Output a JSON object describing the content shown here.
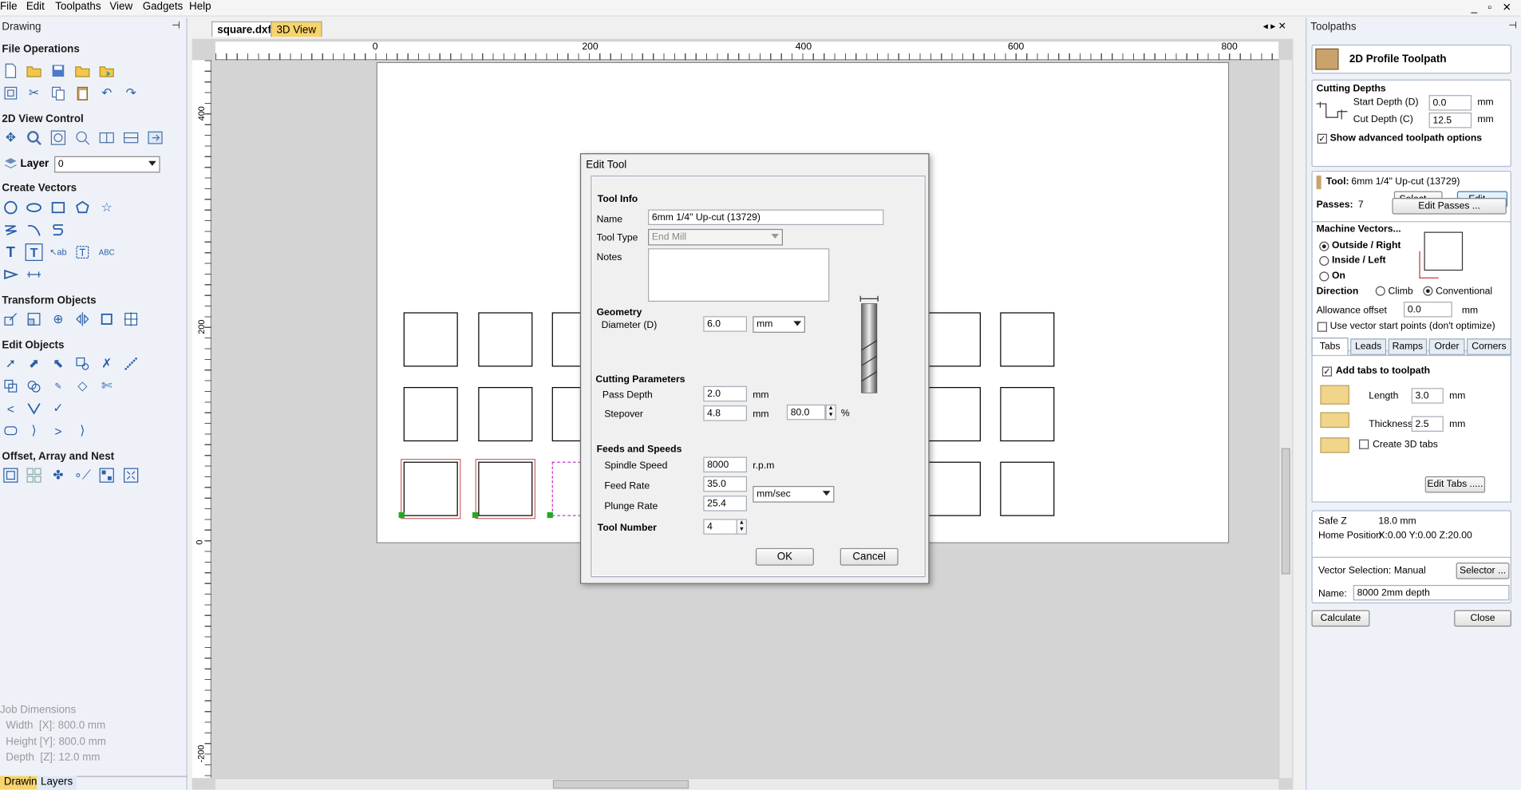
{
  "menu": [
    "File",
    "Edit",
    "Toolpaths",
    "View",
    "Gadgets",
    "Help"
  ],
  "left": {
    "title": "Drawing",
    "sections": {
      "file": "File Operations",
      "view2d": "2D View Control",
      "create": "Create Vectors",
      "transform": "Transform Objects",
      "edit": "Edit Objects",
      "offset": "Offset, Array and Nest"
    },
    "layer_label": "Layer",
    "layer_value": "0",
    "job": {
      "title": "Job Dimensions",
      "width": "Width  [X]: 800.0 mm",
      "height": "Height [Y]: 800.0 mm",
      "depth": "Depth  [Z]: 12.0 mm"
    },
    "bottom_tabs": [
      "Drawing",
      "Layers"
    ]
  },
  "doc_tabs": [
    "square.dxf",
    "3D View"
  ],
  "ruler": {
    "top": [
      "0",
      "200",
      "400",
      "600",
      "800"
    ],
    "left": [
      "400",
      "200",
      "0",
      "-200"
    ]
  },
  "dialog": {
    "title": "Edit Tool",
    "tool_info": "Tool Info",
    "name_label": "Name",
    "name_value": "6mm 1/4\" Up-cut (13729)",
    "tooltype_label": "Tool Type",
    "tooltype_value": "End Mill",
    "notes_label": "Notes",
    "geometry": "Geometry",
    "diameter_label": "Diameter (D)",
    "diameter_value": "6.0",
    "units": "mm",
    "cutting": "Cutting Parameters",
    "passdepth_label": "Pass Depth",
    "passdepth_value": "2.0",
    "passdepth_unit": "mm",
    "stepover_label": "Stepover",
    "stepover_value": "4.8",
    "stepover_unit": "mm",
    "stepover_pct": "80.0",
    "pct": "%",
    "feeds": "Feeds and Speeds",
    "spindle_label": "Spindle Speed",
    "spindle_value": "8000",
    "spindle_unit": "r.p.m",
    "feed_label": "Feed Rate",
    "feed_value": "35.0",
    "rate_units": "mm/sec",
    "plunge_label": "Plunge Rate",
    "plunge_value": "25.4",
    "toolnum_label": "Tool Number",
    "toolnum_value": "4",
    "ok": "OK",
    "cancel": "Cancel"
  },
  "right": {
    "title": "Toolpaths",
    "header": "2D Profile Toolpath",
    "depths": "Cutting Depths",
    "start_label": "Start Depth (D)",
    "start_value": "0.0",
    "cut_label": "Cut Depth (C)",
    "cut_value": "12.5",
    "mm": "mm",
    "advanced": "Show advanced toolpath options",
    "tool_label": "Tool:",
    "tool_value": "6mm 1/4\" Up-cut (13729)",
    "select_btn": "Select ...",
    "edit_btn": "Edit ...",
    "passes_label": "Passes:",
    "passes_value": "7",
    "edit_passes": "Edit Passes ...",
    "machine": "Machine Vectors...",
    "outside": "Outside / Right",
    "inside": "Inside / Left",
    "on": "On",
    "direction": "Direction",
    "climb": "Climb",
    "conventional": "Conventional",
    "allowance_label": "Allowance offset",
    "allowance_value": "0.0",
    "vector_start": "Use vector start points (don't optimize)",
    "tabs": [
      "Tabs",
      "Leads",
      "Ramps",
      "Order",
      "Corners"
    ],
    "add_tabs": "Add tabs to toolpath",
    "length_label": "Length",
    "length_value": "3.0",
    "thickness_label": "Thickness",
    "thickness_value": "2.5",
    "create3d": "Create 3D tabs",
    "edit_tabs": "Edit Tabs .....",
    "safez_label": "Safe Z",
    "safez_value": "18.0 mm",
    "home_label": "Home Position",
    "home_value": "X:0.00 Y:0.00 Z:20.00",
    "vecsel_label": "Vector Selection:",
    "vecsel_value": "Manual",
    "selector_btn": "Selector ...",
    "name_label": "Name:",
    "name_value": "8000 2mm depth",
    "calculate": "Calculate",
    "close": "Close"
  },
  "colors": {
    "accent": "#3c7fb1",
    "panel": "#eef2f8"
  }
}
